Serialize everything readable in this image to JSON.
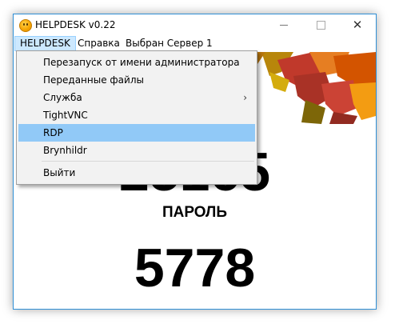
{
  "window": {
    "title": "HELPDESK v0.22",
    "controls": {
      "minimize": "",
      "maximize": "",
      "close": "✕"
    }
  },
  "menubar": {
    "items": [
      "HELPDESK",
      "Справка",
      "Выбран Сервер 1"
    ]
  },
  "dropdown": {
    "items": [
      "Перезапуск от имени администратора",
      "Переданные файлы",
      "Служба",
      "TightVNC",
      "RDP",
      "Brynhildr",
      "Выйти"
    ],
    "submenu_arrow": "›",
    "highlighted": "RDP"
  },
  "main": {
    "id_number": "25165",
    "password_label": "ПАРОЛЬ",
    "password_value": "5778"
  },
  "colors": {
    "accent_border": "#2f8fd6",
    "menu_highlight": "#91c9f7",
    "menu_bg": "#f2f2f2"
  }
}
